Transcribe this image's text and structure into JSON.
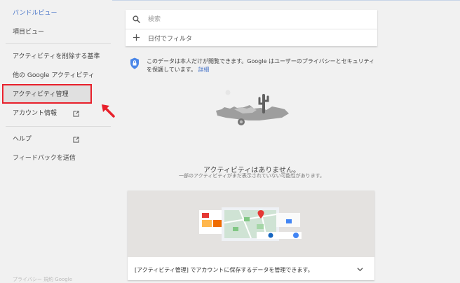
{
  "sidebar": {
    "bundle_view": "バンドルビュー",
    "item_view": "項目ビュー",
    "delete_activity": "アクティビティを削除する基準",
    "other_activity": "他の Google アクティビティ",
    "activity_management": "アクティビティ管理",
    "account_info": "アカウント情報",
    "help": "ヘルプ",
    "feedback": "フィードバックを送信",
    "footer_partial": "プライバシー  規約  Google"
  },
  "search": {
    "placeholder": "検索",
    "filter_label": "日付でフィルタ"
  },
  "privacy": {
    "text": "このデータは本人だけが閲覧できます。Google はユーザーのプライバシーとセキュリティを保護しています。",
    "link": "詳細"
  },
  "empty": {
    "title": "アクティビティはありません。",
    "subtitle": "一部のアクティビティがまだ表示されていない可能性があります。"
  },
  "promo": {
    "text": "[アクティビティ管理] でアカウントに保存するデータを管理できます。"
  },
  "colors": {
    "accent": "#4a76c9",
    "highlight_border": "#e8202b"
  }
}
